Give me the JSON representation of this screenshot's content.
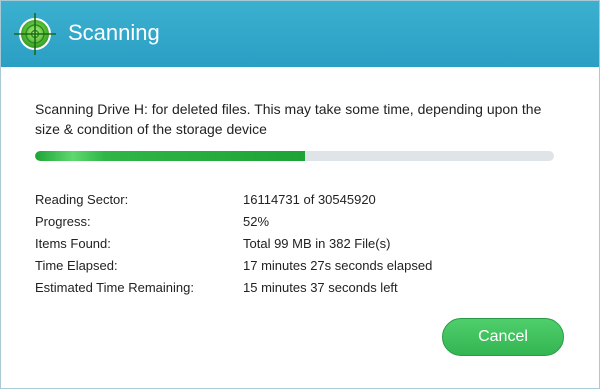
{
  "window": {
    "title": "Scanning",
    "icon": "radar-target-icon"
  },
  "message": "Scanning Drive H: for deleted files. This may take some time, depending upon the size & condition of the storage device",
  "progress": {
    "fraction": 0.52
  },
  "stats": [
    {
      "label": "Reading Sector:",
      "value": "16114731 of 30545920"
    },
    {
      "label": "Progress:",
      "value": "52%"
    },
    {
      "label": "Items Found:",
      "value": "Total 99 MB in 382 File(s)"
    },
    {
      "label": "Time Elapsed:",
      "value": "17 minutes 27s seconds elapsed"
    },
    {
      "label": "Estimated Time Remaining:",
      "value": "15 minutes 37 seconds left"
    }
  ],
  "buttons": {
    "cancel_label": "Cancel"
  },
  "colors": {
    "titlebar": "#2ea7c9",
    "progress_fill": "#1ea436",
    "progress_track": "#dfe4e8",
    "button": "#3dbf5c"
  }
}
